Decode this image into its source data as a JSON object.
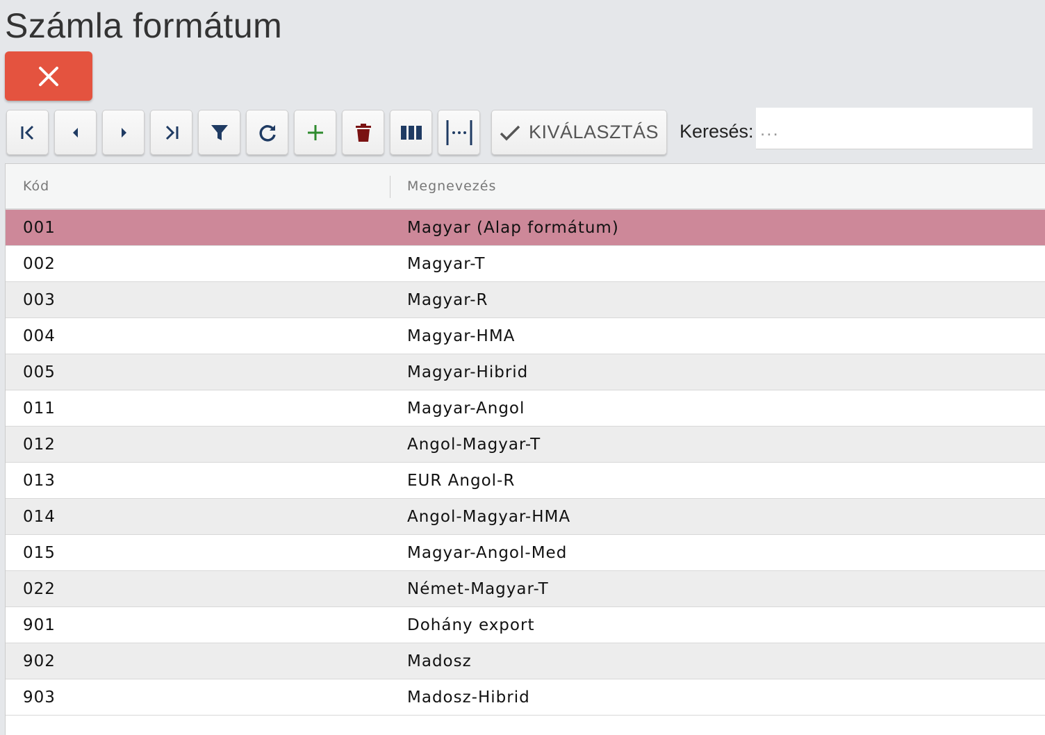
{
  "page": {
    "title": "Számla formátum"
  },
  "colors": {
    "close": "#e4533f",
    "selected_row": "#cd8899",
    "icon_dark": "#1f3b63",
    "icon_add": "#2e8b2e",
    "icon_delete": "#7a1212"
  },
  "toolbar": {
    "buttons": [
      {
        "name": "first-record",
        "icon": "first-page-icon"
      },
      {
        "name": "previous-record",
        "icon": "caret-left-icon"
      },
      {
        "name": "next-record",
        "icon": "caret-right-icon"
      },
      {
        "name": "last-record",
        "icon": "last-page-icon"
      },
      {
        "name": "filter",
        "icon": "filter-icon"
      },
      {
        "name": "refresh",
        "icon": "refresh-icon"
      },
      {
        "name": "add",
        "icon": "plus-icon"
      },
      {
        "name": "delete",
        "icon": "trash-icon"
      },
      {
        "name": "columns",
        "icon": "columns-icon"
      },
      {
        "name": "fit-width",
        "icon": "fit-width-icon"
      }
    ],
    "select_label": "KIVÁLASZTÁS",
    "search_label": "Keresés:",
    "search_placeholder": "...",
    "search_value": ""
  },
  "table": {
    "headers": [
      "Kód",
      "Megnevezés"
    ],
    "selected_index": 0,
    "rows": [
      {
        "code": "001",
        "name": "Magyar (Alap formátum)"
      },
      {
        "code": "002",
        "name": "Magyar-T"
      },
      {
        "code": "003",
        "name": "Magyar-R"
      },
      {
        "code": "004",
        "name": "Magyar-HMA"
      },
      {
        "code": "005",
        "name": "Magyar-Hibrid"
      },
      {
        "code": "011",
        "name": "Magyar-Angol"
      },
      {
        "code": "012",
        "name": "Angol-Magyar-T"
      },
      {
        "code": "013",
        "name": "EUR Angol-R"
      },
      {
        "code": "014",
        "name": "Angol-Magyar-HMA"
      },
      {
        "code": "015",
        "name": "Magyar-Angol-Med"
      },
      {
        "code": "022",
        "name": "Német-Magyar-T"
      },
      {
        "code": "901",
        "name": "Dohány export"
      },
      {
        "code": "902",
        "name": "Madosz"
      },
      {
        "code": "903",
        "name": "Madosz-Hibrid"
      }
    ]
  }
}
